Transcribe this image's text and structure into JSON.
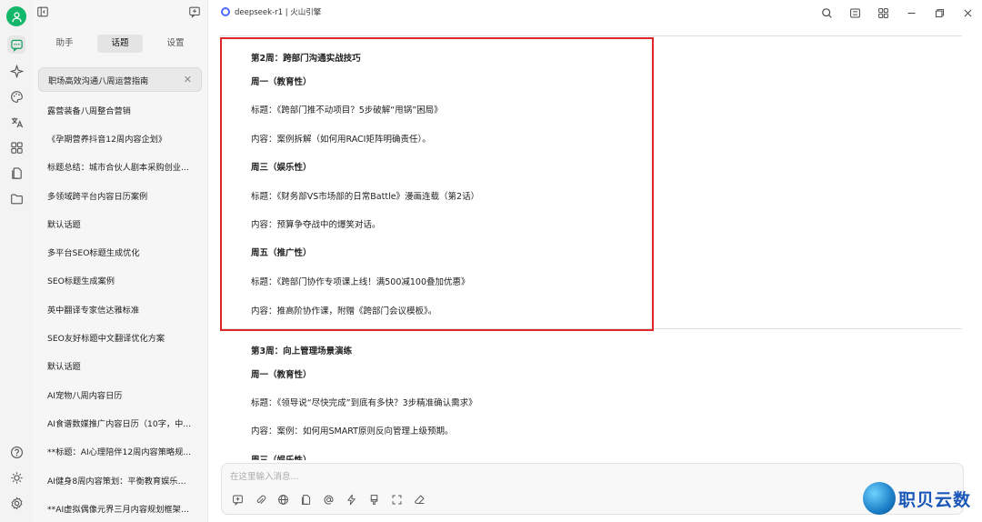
{
  "app": {
    "model_title": "deepseek-r1 | 火山引擎"
  },
  "sidebar": {
    "tabs": [
      {
        "label": "助手"
      },
      {
        "label": "话题"
      },
      {
        "label": "设置"
      }
    ],
    "active_tab": "话题",
    "topics": [
      "职场高效沟通八周运营指南",
      "露营装备八周整合营销",
      "《孕期营养抖音12周内容企划》",
      "标题总结：城市合伙人剧本采购创业...",
      "多领域跨平台内容日历案例",
      "默认话题",
      "多平台SEO标题生成优化",
      "SEO标题生成案例",
      "英中翻译专家信达雅标准",
      "SEO友好标题中文翻译优化方案",
      "默认话题",
      "AI宠物八周内容日历",
      "AI食谱数媒推广内容日历（10字，中...",
      "**标题：AI心理陪伴12周内容策略规...",
      "AI健身8周内容策划：平衡教育娱乐营销",
      "**AI虚拟偶像元界三月内容规划框架*..."
    ]
  },
  "message": {
    "lines": [
      {
        "text": "第2周：跨部门沟通实战技巧",
        "bold": true
      },
      {
        "text": "周一（教育性）",
        "bold": true
      },
      {
        "text": "标题：《跨部门推不动项目？5步破解“甩锅”困局》",
        "bold": false
      },
      {
        "text": "内容：案例拆解（如何用RACI矩阵明确责任）。",
        "bold": false
      },
      {
        "text": "周三（娱乐性）",
        "bold": true
      },
      {
        "text": "标题：《财务部VS市场部的日常Battle》漫画连载（第2话）",
        "bold": false
      },
      {
        "text": "内容：预算争夺战中的爆笑对话。",
        "bold": false
      },
      {
        "text": "周五（推广性）",
        "bold": true
      },
      {
        "text": "标题：《跨部门协作专项课上线！满500减100叠加优惠》",
        "bold": false
      },
      {
        "text": "内容：推高阶协作课，附赠《跨部门会议模板》。",
        "bold": false
      },
      {
        "text": "第3周：向上管理场景演练",
        "bold": true
      },
      {
        "text": "周一（教育性）",
        "bold": true
      },
      {
        "text": "标题：《领导说“尽快完成”到底有多快？3步精准确认需求》",
        "bold": false
      },
      {
        "text": "内容：案例：如何用SMART原则反向管理上级预期。",
        "bold": false
      },
      {
        "text": "周三（娱乐性）",
        "bold": true
      }
    ]
  },
  "composer": {
    "placeholder": "在这里输入消息..."
  },
  "watermark": {
    "text": "职贝云数"
  },
  "colors": {
    "highlight": "#e0262b",
    "accent": "#12b76a"
  }
}
